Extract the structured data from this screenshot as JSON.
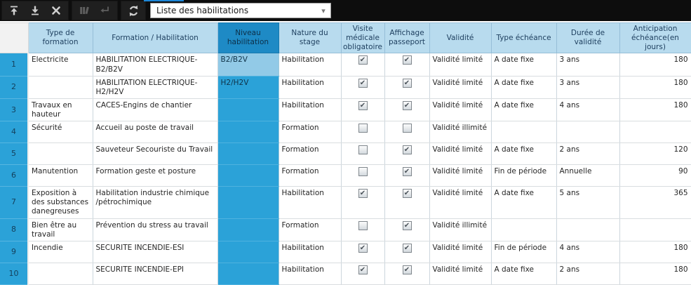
{
  "toolbar": {
    "view_selector": {
      "value": "Liste des habilitations"
    },
    "buttons": [
      {
        "icon": "arrow-up-to-line-icon",
        "enabled": true
      },
      {
        "icon": "arrow-down-to-line-icon",
        "enabled": true
      },
      {
        "icon": "close-icon",
        "enabled": true
      },
      {
        "icon": "books-icon",
        "enabled": false
      },
      {
        "icon": "step-arrow-icon",
        "enabled": false
      },
      {
        "icon": "refresh-icon",
        "enabled": true
      }
    ]
  },
  "grid": {
    "columns": [
      "Type de formation",
      "Formation / Habilitation",
      "Niveau habilitation",
      "Nature du stage",
      "Visite médicale obligatoire",
      "Affichage passeport",
      "Validité",
      "Type échéance",
      "Durée de validité",
      "Anticipation échéance(en jours)"
    ],
    "selected_column": "Niveau habilitation",
    "rows": [
      {
        "num": "1",
        "type": "Electricite",
        "formation": "HABILITATION ELECTRIQUE-B2/B2V",
        "niveau": "B2/B2V",
        "niveau_selected": true,
        "nature": "Habilitation",
        "visite": true,
        "affichage": true,
        "validite": "Validité limité",
        "echeance": "A date fixe",
        "duree": "3 ans",
        "anticipation": "180"
      },
      {
        "num": "2",
        "type": "",
        "formation": "HABILITATION ELECTRIQUE-H2/H2V",
        "niveau": "H2/H2V",
        "nature": "Habilitation",
        "visite": true,
        "affichage": true,
        "validite": "Validité limité",
        "echeance": "A date fixe",
        "duree": "3 ans",
        "anticipation": "180"
      },
      {
        "num": "3",
        "type": "Travaux en hauteur",
        "formation": "CACES-Engins de chantier",
        "niveau": "",
        "nature": "Habilitation",
        "visite": true,
        "affichage": true,
        "validite": "Validité limité",
        "echeance": "A date fixe",
        "duree": "4 ans",
        "anticipation": "180"
      },
      {
        "num": "4",
        "type": "Sécurité",
        "formation": "Accueil au poste de travail",
        "niveau": "",
        "nature": "Formation",
        "visite": false,
        "affichage": false,
        "validite": "Validité illimité",
        "echeance": "",
        "duree": "",
        "anticipation": ""
      },
      {
        "num": "5",
        "type": "",
        "formation": "Sauveteur Secouriste du Travail",
        "niveau": "",
        "nature": "Formation",
        "visite": false,
        "affichage": true,
        "validite": "Validité limité",
        "echeance": "A date fixe",
        "duree": "2 ans",
        "anticipation": "120"
      },
      {
        "num": "6",
        "type": "Manutention",
        "formation": "Formation geste et posture",
        "niveau": "",
        "nature": "Formation",
        "visite": false,
        "affichage": true,
        "validite": "Validité limité",
        "echeance": "Fin de période",
        "duree": "Annuelle",
        "anticipation": "90"
      },
      {
        "num": "7",
        "type": "Exposition à des substances danegreuses",
        "formation": "Habilitation industrie chimique /pétrochimique",
        "niveau": "",
        "nature": "Habilitation",
        "visite": true,
        "affichage": true,
        "validite": "Validité limité",
        "echeance": "A date fixe",
        "duree": "5 ans",
        "anticipation": "365"
      },
      {
        "num": "8",
        "type": "Bien être au travail",
        "formation": "Prévention du stress au travail",
        "niveau": "",
        "nature": "Formation",
        "visite": false,
        "affichage": true,
        "validite": "Validité illimité",
        "echeance": "",
        "duree": "",
        "anticipation": ""
      },
      {
        "num": "9",
        "type": "Incendie",
        "formation": "SECURITE INCENDIE-ESI",
        "niveau": "",
        "nature": "Habilitation",
        "visite": true,
        "affichage": true,
        "validite": "Validité limité",
        "echeance": "Fin de période",
        "duree": "4 ans",
        "anticipation": "180"
      },
      {
        "num": "10",
        "type": "",
        "formation": "SECURITE INCENDIE-EPI",
        "niveau": "",
        "nature": "Habilitation",
        "visite": true,
        "affichage": true,
        "validite": "Validité limité",
        "echeance": "A date fixe",
        "duree": "2 ans",
        "anticipation": "180"
      }
    ]
  },
  "colors": {
    "column_highlight": "#2ba2d8",
    "selected_cell": "#92cae7",
    "header_bg": "#b8dbee",
    "header_selected_bg": "#1e8ac5",
    "toolbar_bg": "#0d0d0d"
  }
}
